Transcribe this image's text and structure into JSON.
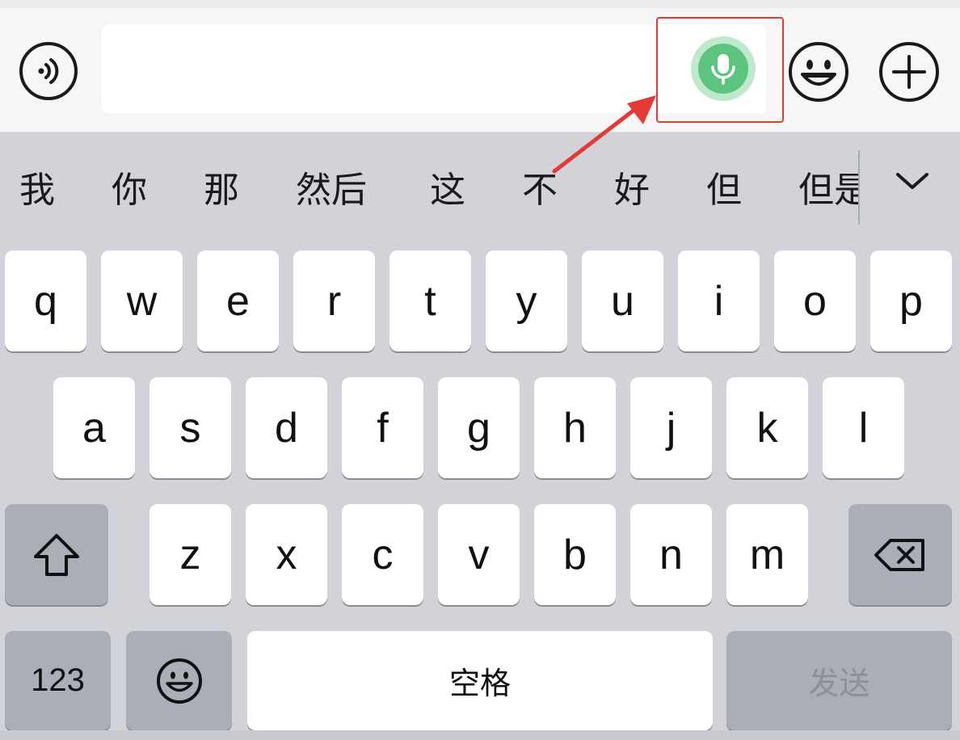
{
  "input_bar": {
    "voice_toggle_icon": "voice-mode-icon",
    "text_value": "",
    "mic_icon": "microphone-icon",
    "emoji_icon": "emoji-icon",
    "plus_icon": "plus-icon",
    "mic_color": "#5dc47f",
    "highlight_color": "#e53935"
  },
  "candidates": {
    "items": [
      "我",
      "你",
      "那",
      "然后",
      "这",
      "不",
      "好",
      "但",
      "但是"
    ],
    "expand_icon": "chevron-down-icon"
  },
  "keyboard": {
    "row1": [
      "q",
      "w",
      "e",
      "r",
      "t",
      "y",
      "u",
      "i",
      "o",
      "p"
    ],
    "row2": [
      "a",
      "s",
      "d",
      "f",
      "g",
      "h",
      "j",
      "k",
      "l"
    ],
    "row3": [
      "z",
      "x",
      "c",
      "v",
      "b",
      "n",
      "m"
    ],
    "shift_icon": "shift-icon",
    "delete_icon": "backspace-icon",
    "numbers_label": "123",
    "emoji_key_icon": "emoji-icon",
    "space_label": "空格",
    "send_label": "发送"
  }
}
